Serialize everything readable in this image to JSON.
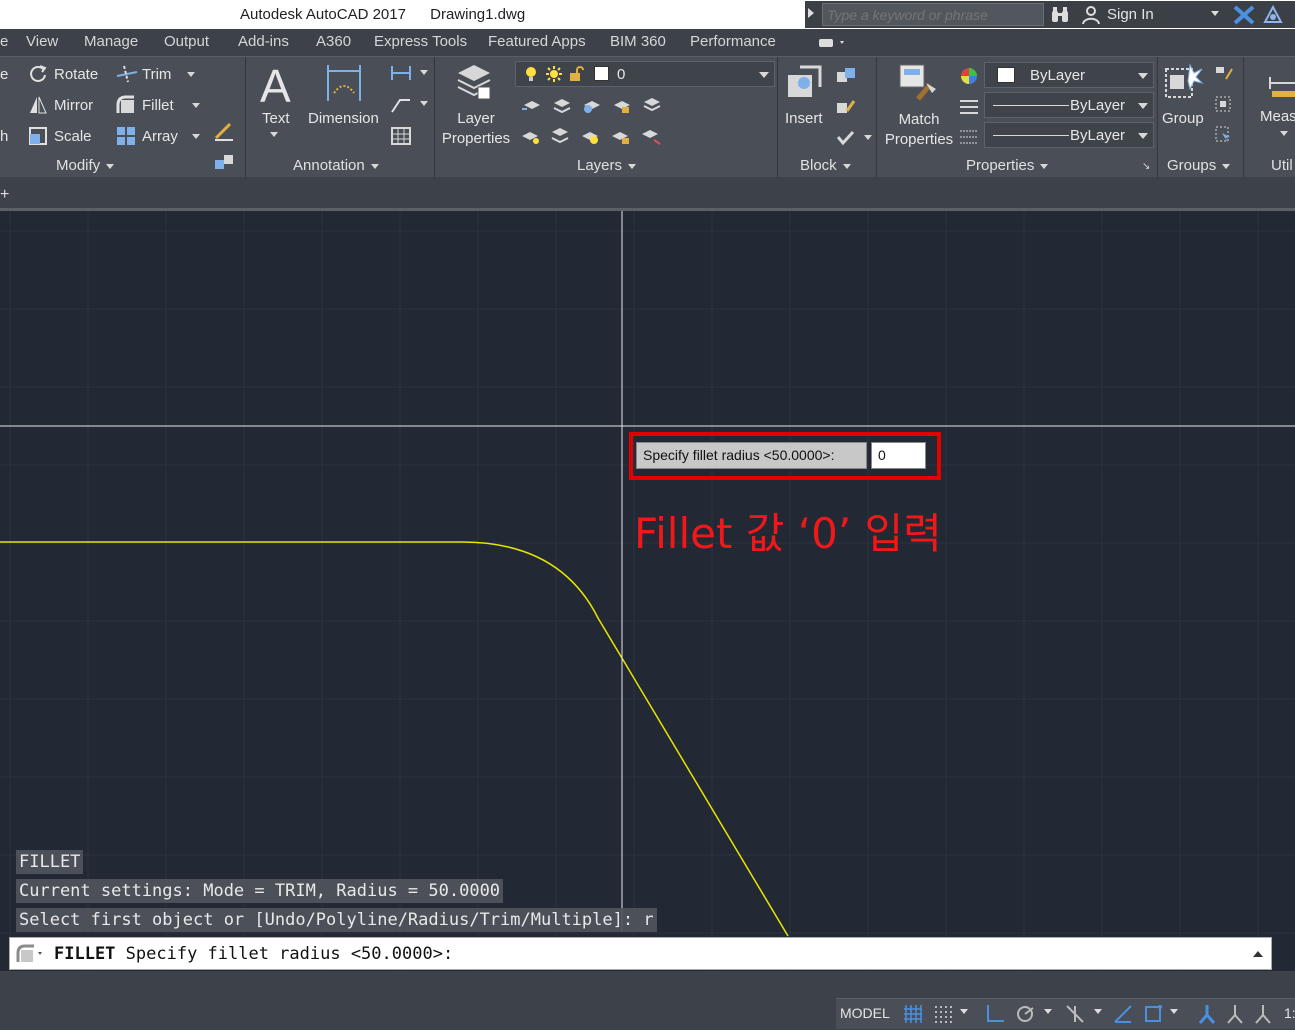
{
  "titlebar": {
    "app_title": "Autodesk AutoCAD 2017",
    "file_name": "Drawing1.dwg",
    "search_placeholder": "Type a keyword or phrase",
    "signin_label": "Sign In"
  },
  "tabs": [
    "View",
    "Manage",
    "Output",
    "Add-ins",
    "A360",
    "Express Tools",
    "Featured Apps",
    "BIM 360",
    "Performance"
  ],
  "ribbon": {
    "modify": {
      "title": "Modify",
      "rotate": "Rotate",
      "mirror": "Mirror",
      "scale": "Scale",
      "trim": "Trim",
      "fillet": "Fillet",
      "array": "Array"
    },
    "annotation": {
      "title": "Annotation",
      "text": "Text",
      "dimension": "Dimension"
    },
    "layers": {
      "title": "Layers",
      "layer_properties_l1": "Layer",
      "layer_properties_l2": "Properties",
      "current_layer": "0"
    },
    "block": {
      "title": "Block",
      "insert": "Insert"
    },
    "properties": {
      "title": "Properties",
      "match_l1": "Match",
      "match_l2": "Properties",
      "color": "ByLayer",
      "linetype": "ByLayer",
      "lineweight": "ByLayer"
    },
    "groups": {
      "title": "Groups",
      "group": "Group"
    },
    "utilities": {
      "title": "Util",
      "measure": "Meas"
    }
  },
  "canvas": {
    "dynamic_prompt_label": "Specify fillet radius <50.0000>:",
    "dynamic_prompt_value": "0",
    "annotation_text": "Fillet 값 ‘0’ 입력"
  },
  "command_history": [
    "FILLET",
    "Current settings: Mode = TRIM, Radius = 50.0000",
    "Select first object or [Undo/Polyline/Radius/Trim/Multiple]: r"
  ],
  "command_line": {
    "command": "FILLET",
    "prompt": " Specify fillet radius <50.0000>:"
  },
  "statusbar": {
    "model_label": "MODEL",
    "trailing": "1:"
  },
  "colors": {
    "canvas_bg": "#222834",
    "grid": "#2f3644",
    "curve": "#e6e600",
    "highlight": "#e30000"
  }
}
